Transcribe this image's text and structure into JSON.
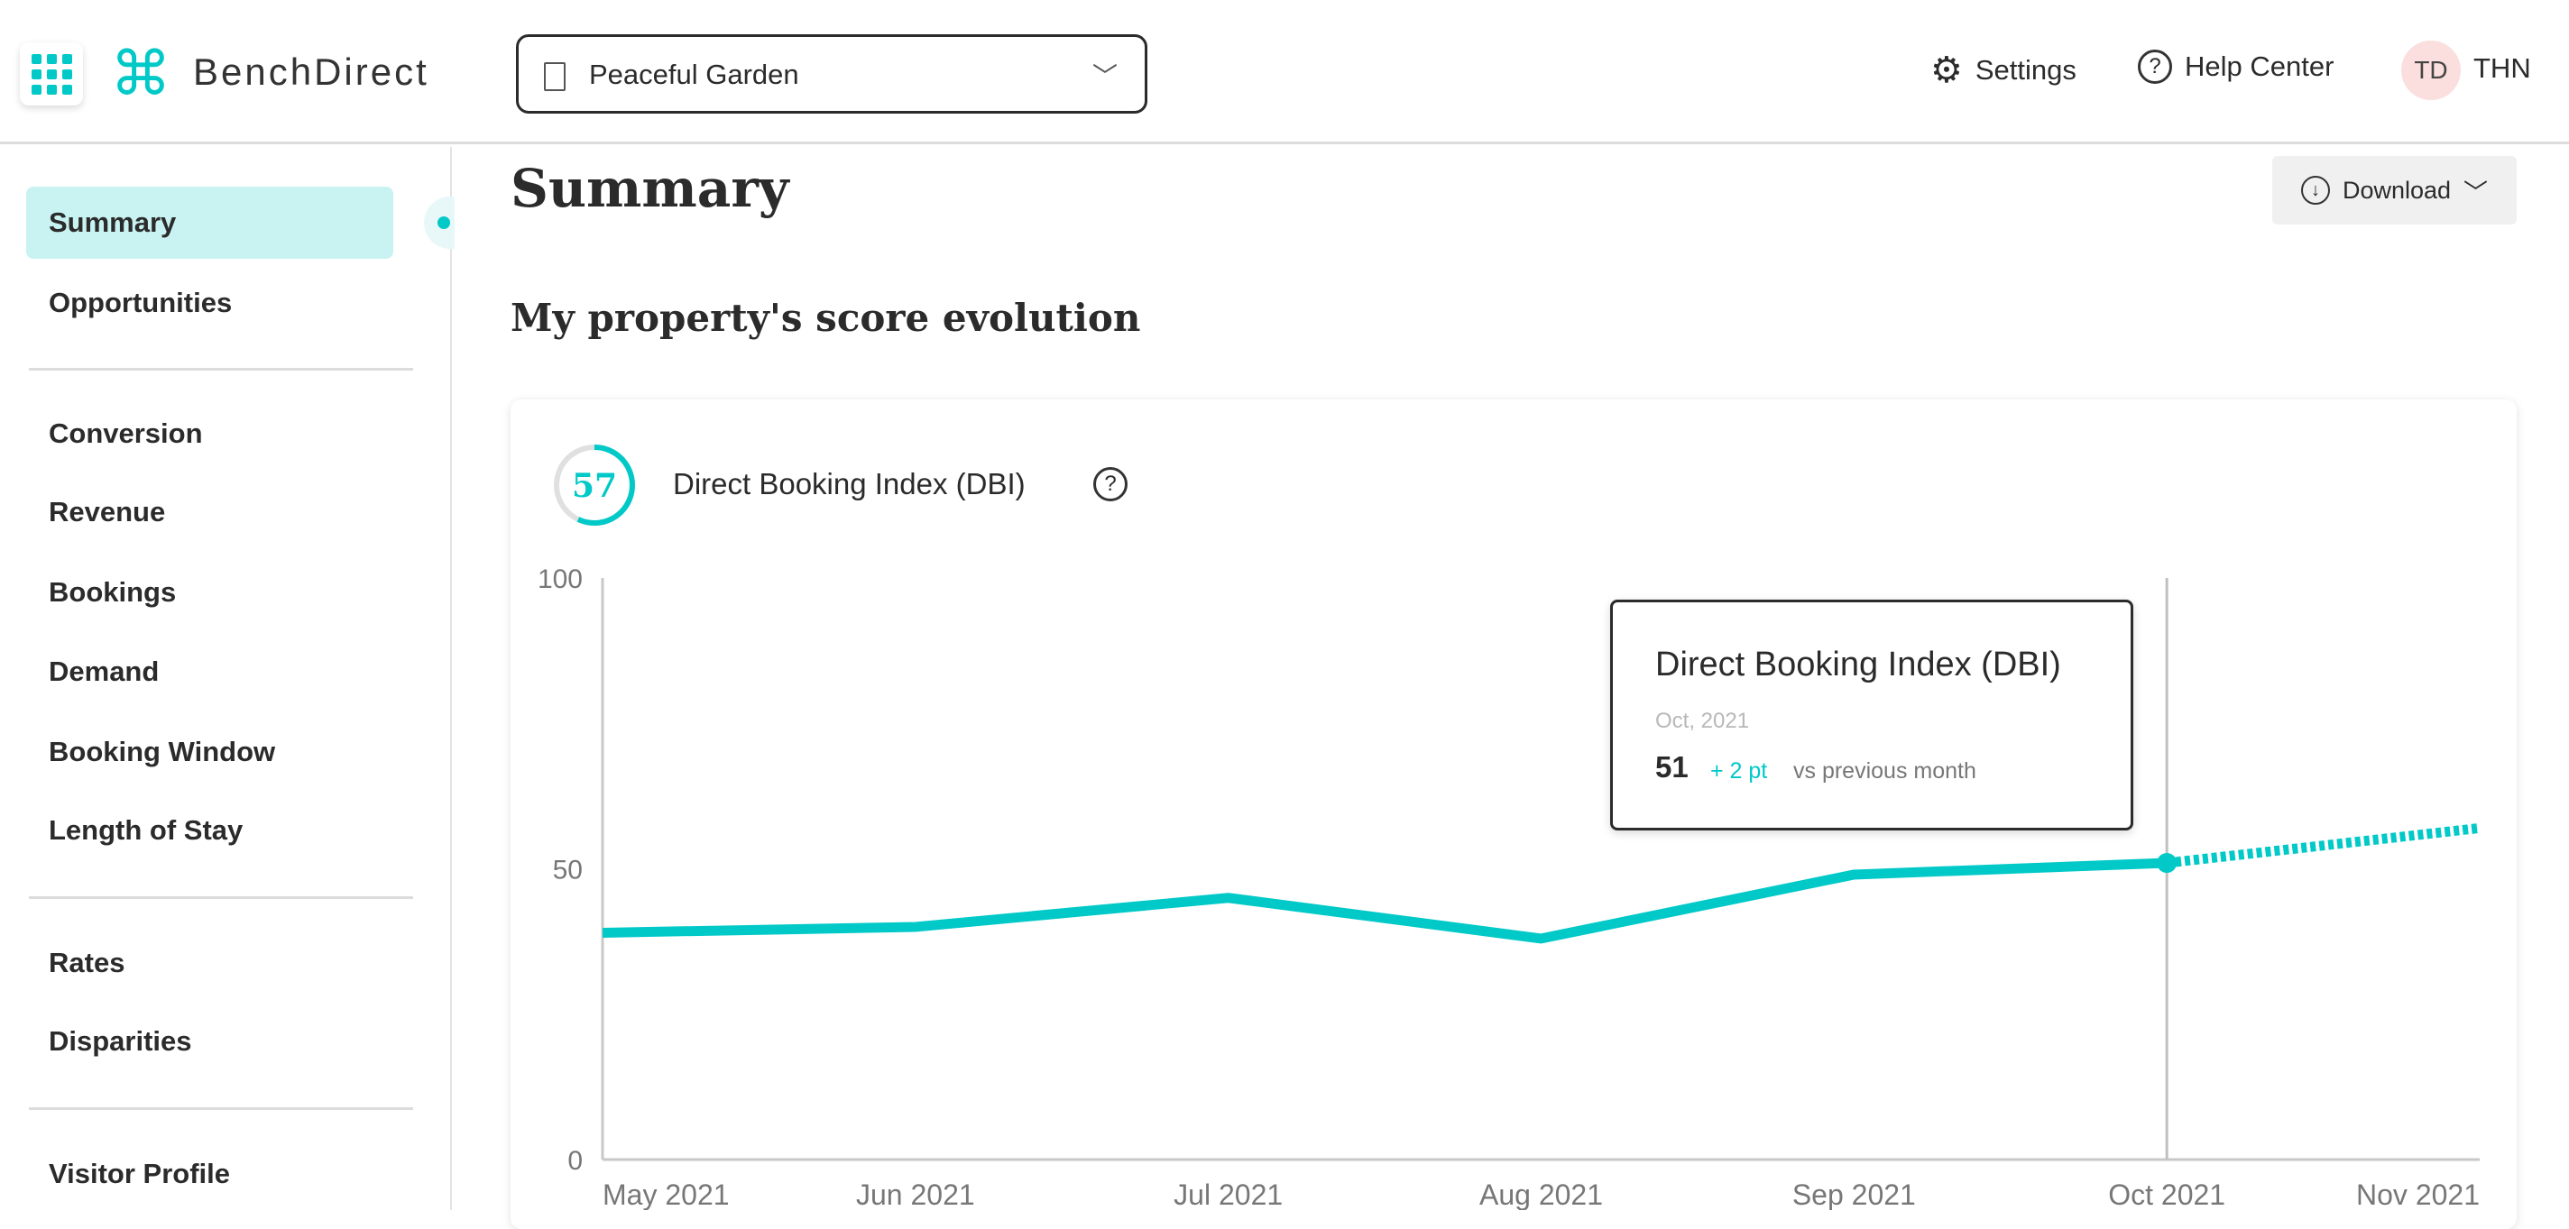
{
  "header": {
    "brand": "BenchDirect",
    "property": "Peaceful Garden",
    "settings": "Settings",
    "help": "Help Center",
    "avatar_initials": "TD",
    "user": "THN"
  },
  "sidebar": {
    "items": [
      {
        "label": "Summary",
        "active": true
      },
      {
        "label": "Opportunities"
      },
      {
        "label": "Conversion"
      },
      {
        "label": "Revenue"
      },
      {
        "label": "Bookings"
      },
      {
        "label": "Demand"
      },
      {
        "label": "Booking Window"
      },
      {
        "label": "Length of Stay"
      },
      {
        "label": "Rates"
      },
      {
        "label": "Disparities"
      },
      {
        "label": "Visitor Profile"
      }
    ]
  },
  "main": {
    "title": "Summary",
    "download": "Download",
    "section_title": "My property's score evolution"
  },
  "card": {
    "score": "57",
    "score_fraction": 0.57,
    "label": "Direct Booking Index (DBI)"
  },
  "tooltip": {
    "title": "Direct Booking Index (DBI)",
    "date": "Oct, 2021",
    "value": "51",
    "change": "+ 2 pt",
    "change_suffix": "vs previous month"
  },
  "colors": {
    "accent": "#00c9c8",
    "active_bg": "#c8f3f2"
  },
  "chart_data": {
    "type": "line",
    "categories": [
      "May 2021",
      "Jun 2021",
      "Jul 2021",
      "Aug 2021",
      "Sep 2021",
      "Oct 2021",
      "Nov 2021"
    ],
    "values": [
      39,
      40,
      45,
      38,
      49,
      51,
      57
    ],
    "projected_from_index": 5,
    "highlight_index": 5,
    "ylim": [
      0,
      100
    ],
    "yticks": [
      "0",
      "50",
      "100"
    ],
    "grid": false
  }
}
